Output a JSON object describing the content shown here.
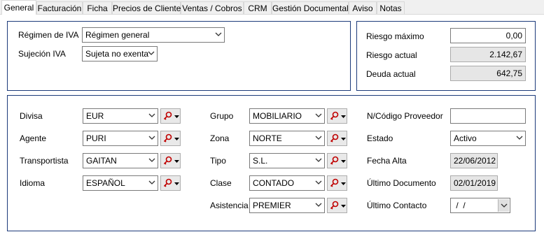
{
  "tabs": [
    {
      "label": "General",
      "active": true
    },
    {
      "label": "Facturación"
    },
    {
      "label": "Ficha"
    },
    {
      "label": "Precios de Cliente"
    },
    {
      "label": "Ventas / Cobros"
    },
    {
      "label": "CRM"
    },
    {
      "label": "Gestión Documental"
    },
    {
      "label": "Aviso"
    },
    {
      "label": "Notas"
    }
  ],
  "iva": {
    "regimen_label": "Régimen de IVA",
    "regimen_value": "Régimen general",
    "sujecion_label": "Sujeción IVA",
    "sujecion_value": "Sujeta no exenta"
  },
  "riesgo": {
    "maximo_label": "Riesgo máximo",
    "maximo_value": "0,00",
    "actual_label": "Riesgo actual",
    "actual_value": "2.142,67",
    "deuda_label": "Deuda actual",
    "deuda_value": "642,75"
  },
  "col1": {
    "divisa_label": "Divisa",
    "divisa_value": "EUR",
    "agente_label": "Agente",
    "agente_value": "PURI",
    "transportista_label": "Transportista",
    "transportista_value": "GAITAN",
    "idioma_label": "Idioma",
    "idioma_value": "ESPAÑOL"
  },
  "col2": {
    "grupo_label": "Grupo",
    "grupo_value": "MOBILIARIO",
    "zona_label": "Zona",
    "zona_value": "NORTE",
    "tipo_label": "Tipo",
    "tipo_value": "S.L.",
    "clase_label": "Clase",
    "clase_value": "CONTADO",
    "asistencia_label": "Asistencia",
    "asistencia_value": "PREMIER"
  },
  "col3": {
    "proveedor_label": "N/Código Proveedor",
    "proveedor_value": "",
    "estado_label": "Estado",
    "estado_value": "Activo",
    "fecha_alta_label": "Fecha Alta",
    "fecha_alta_value": "22/06/2012",
    "ultimo_doc_label": "Último Documento",
    "ultimo_doc_value": "02/01/2019",
    "ultimo_contacto_label": "Último Contacto",
    "ultimo_contacto_value": " /  /"
  },
  "icons": {
    "lookup": "key-search-icon",
    "dropdown": "chevron-down-icon"
  },
  "colors": {
    "panel_border": "#1c3a7a",
    "readonly_bg": "#e6e6e6"
  }
}
